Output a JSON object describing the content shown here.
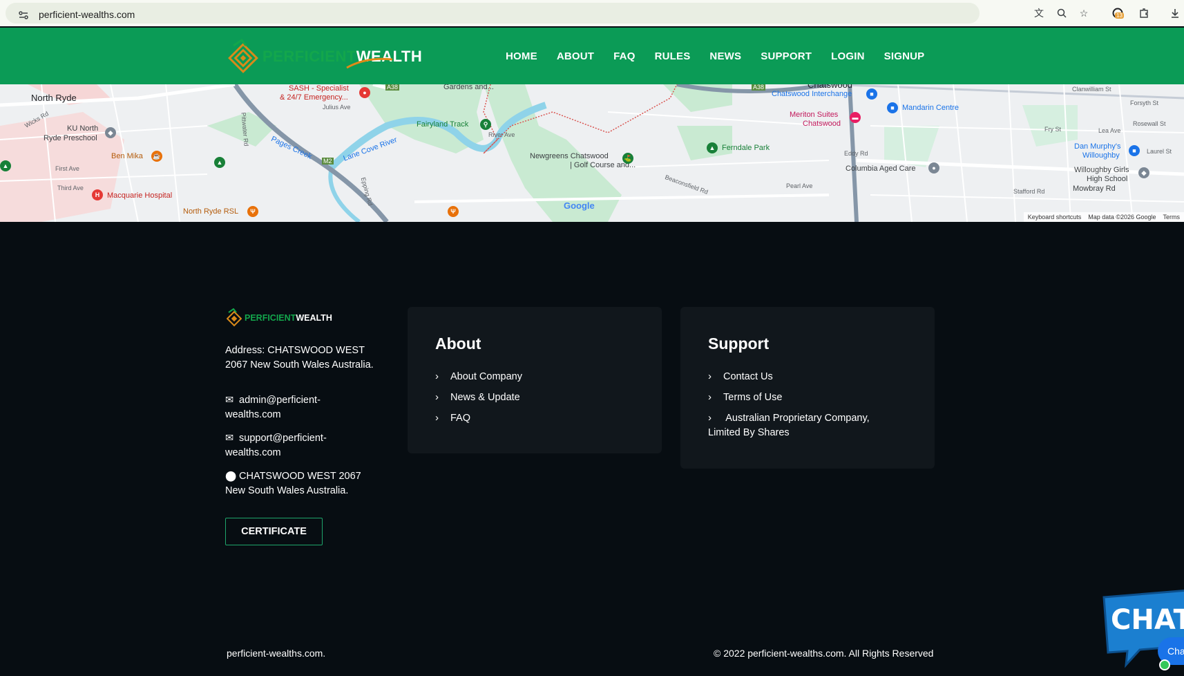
{
  "browser": {
    "url": "perficient-wealths.com",
    "extension_badge": "13"
  },
  "header": {
    "logo_part1": "PERFICIENT",
    "logo_part2": "WEALTH",
    "nav": [
      "HOME",
      "ABOUT",
      "FAQ",
      "RULES",
      "NEWS",
      "SUPPORT",
      "LOGIN",
      "SIGNUP"
    ]
  },
  "map": {
    "labels": {
      "north_ryde": "North Ryde",
      "ku_north": "KU North",
      "ryde_preschool": "Ryde Preschool",
      "ben_mika": "Ben Mika",
      "macquarie": "Macquarie Hospital",
      "north_ryde_rsl": "North Ryde RSL",
      "sash1": "SASH - Specialist",
      "sash2": "& 24/7 Emergency...",
      "gardens": "Gardens and...",
      "fairyland": "Fairyland Track",
      "lane_cove": "Lane Cove River",
      "pages_creek": "Pages Creek",
      "newgreens1": "Newgreens Chatswood",
      "newgreens2": "| Golf Course and...",
      "chatswood": "Chatswood",
      "interchange": "Chatswood Interchange",
      "mandarin": "Mandarin Centre",
      "meriton1": "Meriton Suites",
      "meriton2": "Chatswood",
      "ferndale": "Ferndale Park",
      "columbia": "Columbia Aged Care",
      "dan_murphy1": "Dan Murphy's",
      "dan_murphy2": "Willoughby",
      "willoughby1": "Willoughby Girls",
      "willoughby2": "High School",
      "wicks_rd": "Wicks Rd",
      "pittwater": "Pittwater Rd",
      "epping": "Epping Rd",
      "first_ave": "First Ave",
      "third_ave": "Third Ave",
      "eddy_rd": "Eddy Rd",
      "pearl_ave": "Pearl Ave",
      "beaconsfield": "Beaconsfield Rd",
      "stafford": "Stafford Rd",
      "mowbray": "Mowbray Rd",
      "river_ave": "River Ave",
      "julius": "Julius Ave",
      "fry_st": "Fry St",
      "lea_ave": "Lea Ave",
      "forsyth": "Forsyth St",
      "clanwilliam": "Clanwilliam St",
      "rosewall": "Rosewall St",
      "laurel": "Laurel St",
      "a38": "A38",
      "m2": "M2"
    },
    "google": "Google",
    "footer": [
      "Keyboard shortcuts",
      "Map data ©2026 Google",
      "Terms"
    ]
  },
  "footer": {
    "logo_part1": "PERFICIENT",
    "logo_part2": "WEALTH",
    "address_line1": "Address: CHATSWOOD WEST",
    "address_line2": "2067 New South Wales Australia.",
    "email1_line1": "admin@perficient-",
    "email1_line2": "wealths.com",
    "email2_line1": "support@perficient-",
    "email2_line2": "wealths.com",
    "location_line1": "CHATSWOOD WEST 2067",
    "location_line2": "New South Wales Australia.",
    "certificate": "CERTIFICATE",
    "about": {
      "title": "About",
      "items": [
        "About Company",
        "News & Update",
        "FAQ"
      ]
    },
    "support": {
      "title": "Support",
      "items": [
        "Contact Us",
        "Terms of Use",
        "Australian Proprietary Company,",
        "Limited By Shares"
      ]
    },
    "bottom_left": "perficient-wealths.com.",
    "bottom_right": "© 2022 perficient-wealths.com. All Rights Reserved"
  },
  "chat": {
    "big": "CHAT",
    "small": "Cha"
  }
}
